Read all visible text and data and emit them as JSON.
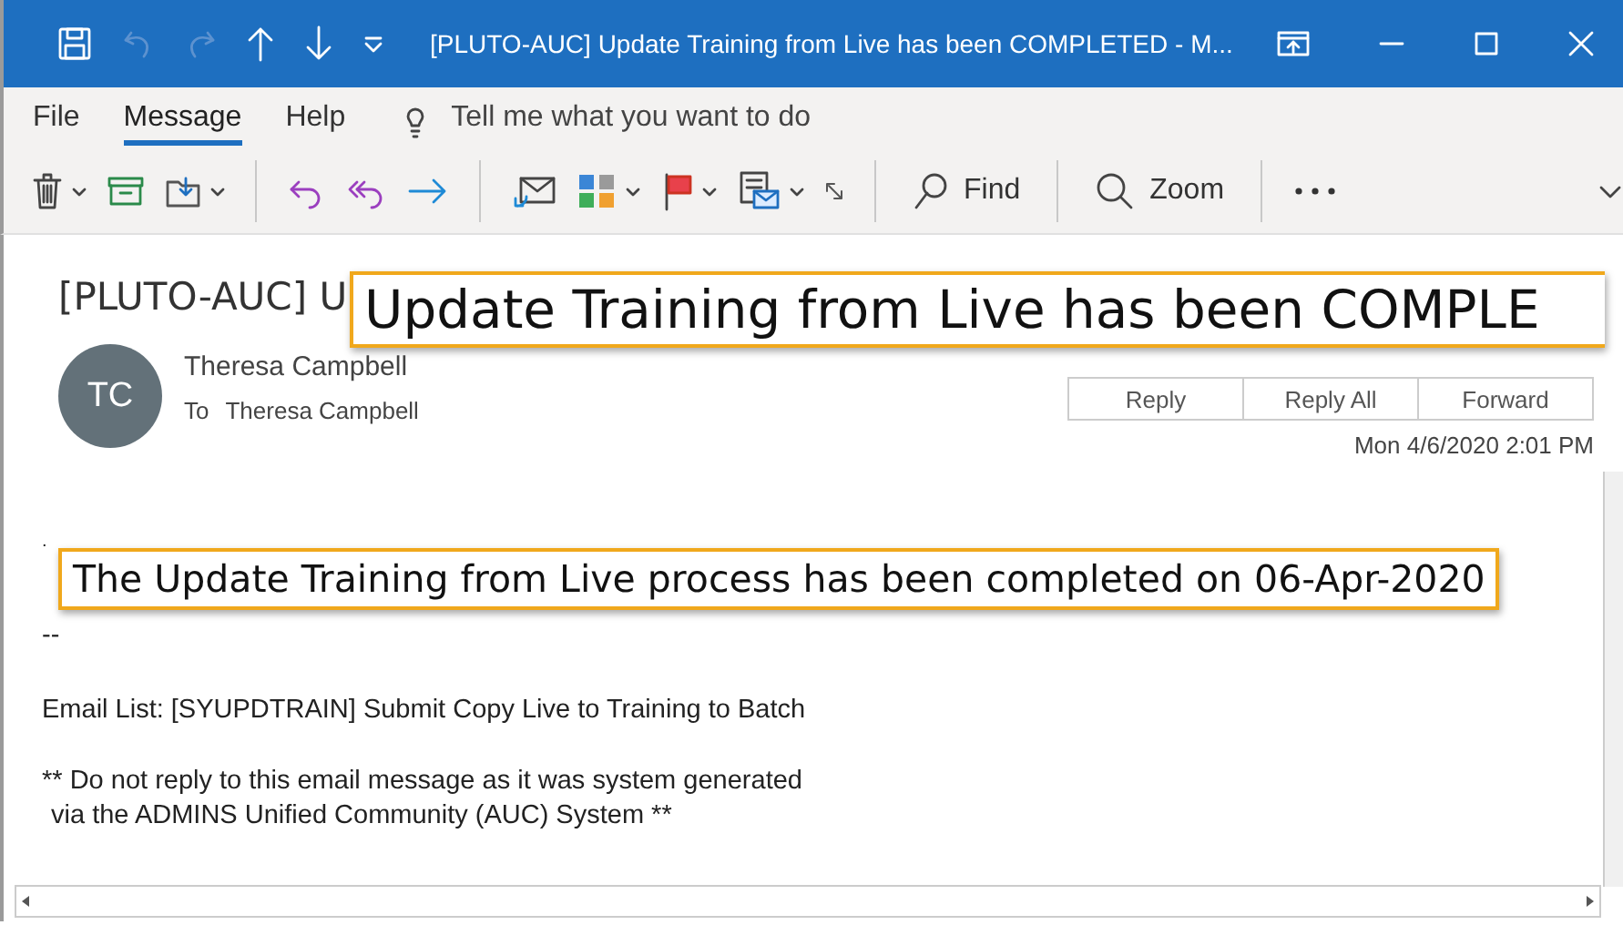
{
  "window": {
    "title": "[PLUTO-AUC] Update Training from Live has been COMPLETED  -  M..."
  },
  "menu_tabs": [
    {
      "label": "File",
      "selected": false
    },
    {
      "label": "Message",
      "selected": true
    },
    {
      "label": "Help",
      "selected": false
    }
  ],
  "tell_me": {
    "placeholder": "Tell me what you want to do"
  },
  "toolbar": {
    "find": "Find",
    "zoom": "Zoom"
  },
  "message": {
    "subject": "[PLUTO-AUC] U",
    "avatar": "TC",
    "sender": "Theresa Campbell",
    "to_label": "To",
    "recipient": "Theresa Campbell",
    "date": "Mon 4/6/2020 2:01 PM",
    "actions": [
      "Reply",
      "Reply All",
      "Forward"
    ]
  },
  "callouts": [
    "Update Training from Live has been COMPLE",
    "The Update Training from Live process has been completed on 06-Apr-2020"
  ],
  "body": {
    "mark": ".",
    "separator": "--",
    "email_list": "Email List: [SYUPDTRAIN] Submit Copy Live to Training to Batch",
    "notice": [
      "** Do not reply to this email message as it was system generated",
      "via the ADMINS Unified Community (AUC) System **"
    ]
  }
}
